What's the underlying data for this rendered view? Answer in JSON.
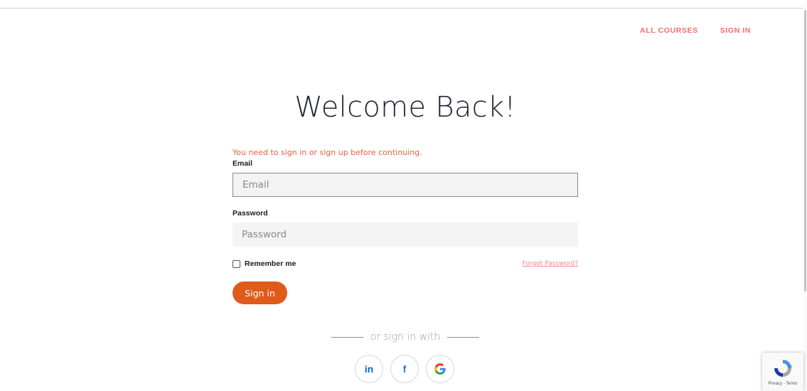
{
  "nav": {
    "all_courses": "ALL COURSES",
    "sign_in": "SIGN IN"
  },
  "page": {
    "title": "Welcome Back!"
  },
  "form": {
    "alert": "You need to sign in or sign up before continuing.",
    "email_label": "Email",
    "email_placeholder": "Email",
    "password_label": "Password",
    "password_placeholder": "Password",
    "remember_label": "Remember me",
    "remember_checked": false,
    "forgot_label": "Forgot Password?",
    "submit_label": "Sign in"
  },
  "social": {
    "divider_text": "or sign in with",
    "providers": [
      {
        "name": "linkedin",
        "icon": "linkedin-icon",
        "glyph": "in"
      },
      {
        "name": "facebook",
        "icon": "facebook-icon",
        "glyph": "f"
      },
      {
        "name": "google",
        "icon": "google-icon",
        "glyph": "G"
      }
    ]
  },
  "recaptcha": {
    "terms": "Privacy - Terms"
  },
  "colors": {
    "accent": "#de5b1c",
    "nav_link": "#f26d6d",
    "alert": "#e0653a",
    "forgot_link": "#f08787"
  }
}
